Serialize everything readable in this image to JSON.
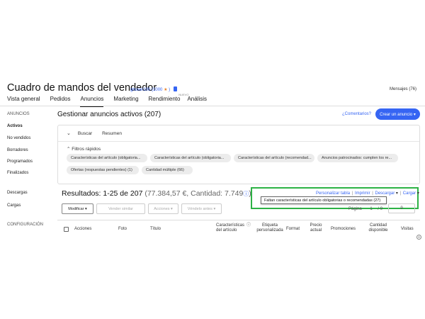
{
  "header": {
    "title": "Cuadro de mandos del vendedor",
    "username": "ghuser100",
    "feedback_score": "(1000",
    "feedback_star": "★",
    "feedback_close": ")",
    "messages": "Mensajes (76)"
  },
  "nav": {
    "tabs": [
      {
        "label": "Vista general"
      },
      {
        "label": "Pedidos"
      },
      {
        "label": "Anuncios"
      },
      {
        "label": "Marketing"
      },
      {
        "label": "Rendimiento",
        "badge": "NUEVO"
      },
      {
        "label": "Análisis"
      }
    ]
  },
  "sidebar": {
    "section_anuncios": "ANUNCIOS",
    "activos": "Activos",
    "no_vendidos": "No vendidos",
    "borradores": "Borradores",
    "programados": "Programados",
    "finalizados": "Finalizados",
    "descargas": "Descargas",
    "cargas": "Cargas",
    "configuracion": "CONFIGURACIÓN"
  },
  "main": {
    "title": "Gestionar anuncios activos (207)",
    "feedback_link": "¿Comentarios?",
    "create_button": "Crear un anuncio ▾"
  },
  "panel": {
    "chevron": "⌄",
    "tab_buscar": "Buscar",
    "tab_resumen": "Resumen",
    "filters_label": "⌃  Filtros rápidos",
    "chips": [
      "Características del artículo (obligatoria...",
      "Características del artículo (obligatoria...",
      "Características del artículo (recomendad...",
      "Anuncios patrocinados: cumplen los re...",
      "Ofertas (respuestas pendientes) (1)",
      "Cantidad múltiple (66)"
    ]
  },
  "results": {
    "label": "Resultados: 1-25 de 207",
    "summary": " (77.384,57 €, Cantidad: 7.749",
    "info_icon": "ⓘ",
    "close_paren": ")"
  },
  "toolbar": {
    "modificar": "Modificar ▾",
    "vender_similar": "Vender similar",
    "acciones": "Acciones ▾",
    "vendelo_antes": "Véndelo antes ▾"
  },
  "links": {
    "personalizar": "Personalizar tabla",
    "imprimir": "Imprimir",
    "descargar": "Descargar",
    "cargar": "Cargar",
    "separator": "|",
    "dropdown_arrow": "▾"
  },
  "tooltip": {
    "text": "Faltan características del artículo obligatorias o recomendadas (27)"
  },
  "pager": {
    "label": "Página",
    "value": "1",
    "of": "/ 9",
    "box": "9"
  },
  "table": {
    "headers": {
      "acciones": "Acciones",
      "foto": "Foto",
      "titulo": "Título",
      "caracteristicas": "Características del artículo",
      "etiqueta": "Etiqueta personalizada",
      "formato": "Format",
      "precio": "Precio actual",
      "promociones": "Promociones",
      "cantidad": "Cantidad disponible",
      "visitas": "Visitas"
    },
    "info_icon": "ⓘ",
    "scroll_icon": "+"
  },
  "colors": {
    "accent": "#3665f3",
    "highlight": "#2db245"
  }
}
